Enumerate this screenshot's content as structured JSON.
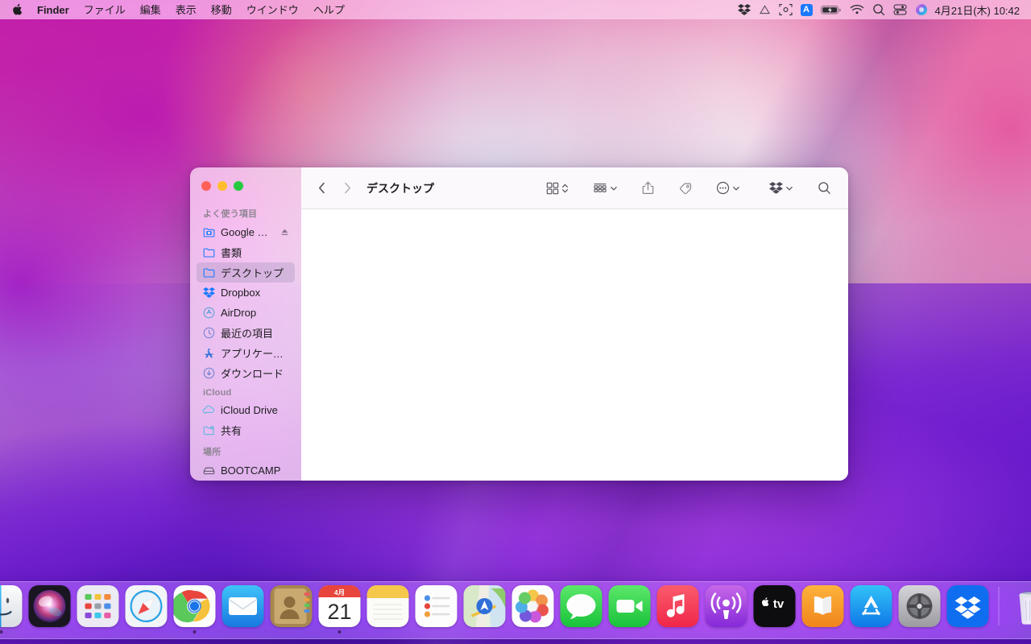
{
  "menubar": {
    "apple_icon": "apple-logo-icon",
    "app_name": "Finder",
    "items": [
      {
        "label": "Finder",
        "bold": true
      },
      {
        "label": "ファイル",
        "bold": false
      },
      {
        "label": "編集",
        "bold": false
      },
      {
        "label": "表示",
        "bold": false
      },
      {
        "label": "移動",
        "bold": false
      },
      {
        "label": "ウインドウ",
        "bold": false
      },
      {
        "label": "ヘルプ",
        "bold": false
      }
    ],
    "status_icons": [
      {
        "name": "dropbox-menu-icon"
      },
      {
        "name": "google-drive-menu-icon"
      },
      {
        "name": "screenshot-capture-icon"
      },
      {
        "name": "input-source-icon",
        "label": "A"
      },
      {
        "name": "battery-charging-icon"
      },
      {
        "name": "wifi-icon"
      },
      {
        "name": "spotlight-search-icon"
      },
      {
        "name": "control-center-icon"
      },
      {
        "name": "siri-icon"
      }
    ],
    "clock": "4月21日(木)  10:42"
  },
  "finder": {
    "window_title": "デスクトップ",
    "traffic_lights": [
      {
        "name": "close-button",
        "color": "#ff6159"
      },
      {
        "name": "minimize-button",
        "color": "#ffbd2e"
      },
      {
        "name": "maximize-button",
        "color": "#27c93f"
      }
    ],
    "sidebar": {
      "groups": [
        {
          "title": "よく使う項目",
          "items": [
            {
              "label": "Google Dri...",
              "icon": "google-drive-folder-icon",
              "eject": true,
              "selected": false
            },
            {
              "label": "書類",
              "icon": "documents-folder-icon",
              "eject": false,
              "selected": false
            },
            {
              "label": "デスクトップ",
              "icon": "desktop-folder-icon",
              "eject": false,
              "selected": true
            },
            {
              "label": "Dropbox",
              "icon": "dropbox-icon",
              "eject": false,
              "selected": false
            },
            {
              "label": "AirDrop",
              "icon": "airdrop-icon",
              "eject": false,
              "selected": false
            },
            {
              "label": "最近の項目",
              "icon": "recents-clock-icon",
              "eject": false,
              "selected": false
            },
            {
              "label": "アプリケーション",
              "icon": "applications-icon",
              "eject": false,
              "selected": false
            },
            {
              "label": "ダウンロード",
              "icon": "downloads-icon",
              "eject": false,
              "selected": false
            }
          ]
        },
        {
          "title": "iCloud",
          "items": [
            {
              "label": "iCloud Drive",
              "icon": "icloud-drive-icon",
              "eject": false,
              "selected": false
            },
            {
              "label": "共有",
              "icon": "shared-folder-icon",
              "eject": false,
              "selected": false
            }
          ]
        },
        {
          "title": "場所",
          "items": [
            {
              "label": "BOOTCAMP",
              "icon": "external-disk-icon",
              "eject": false,
              "selected": false
            }
          ]
        }
      ]
    },
    "toolbar": {
      "back": {
        "name": "back-button",
        "enabled": true
      },
      "forward": {
        "name": "forward-button",
        "enabled": false
      },
      "buttons": [
        {
          "name": "view-mode-icon-grid",
          "caret": "updown"
        },
        {
          "name": "group-by-button",
          "caret": "down"
        },
        {
          "name": "share-button",
          "caret": "none"
        },
        {
          "name": "tag-button",
          "caret": "none"
        },
        {
          "name": "more-actions-button",
          "caret": "down"
        },
        {
          "name": "dropbox-toolbar-button",
          "caret": "down"
        },
        {
          "name": "search-button",
          "caret": "none"
        }
      ]
    },
    "content": {
      "empty": true,
      "items": []
    }
  },
  "dock": {
    "apps": [
      {
        "name": "finder",
        "label": "Finder",
        "running": true
      },
      {
        "name": "siri",
        "label": "Siri",
        "running": false
      },
      {
        "name": "launchpad",
        "label": "Launchpad",
        "running": false
      },
      {
        "name": "safari",
        "label": "Safari",
        "running": false
      },
      {
        "name": "chrome",
        "label": "Google Chrome",
        "running": true
      },
      {
        "name": "mail",
        "label": "メール",
        "running": false
      },
      {
        "name": "contacts",
        "label": "連絡先",
        "running": false
      },
      {
        "name": "calendar",
        "label": "カレンダー",
        "running": true,
        "month": "4月",
        "day": "21"
      },
      {
        "name": "notes",
        "label": "メモ",
        "running": false
      },
      {
        "name": "reminders",
        "label": "リマインダー",
        "running": false
      },
      {
        "name": "maps",
        "label": "マップ",
        "running": false
      },
      {
        "name": "photos",
        "label": "写真",
        "running": false
      },
      {
        "name": "messages",
        "label": "メッセージ",
        "running": false
      },
      {
        "name": "facetime",
        "label": "FaceTime",
        "running": false
      },
      {
        "name": "music",
        "label": "ミュージック",
        "running": false
      },
      {
        "name": "podcasts",
        "label": "Podcast",
        "running": false
      },
      {
        "name": "appletv",
        "label": "Apple TV",
        "running": false
      },
      {
        "name": "books",
        "label": "ブック",
        "running": false
      },
      {
        "name": "appstore",
        "label": "App Store",
        "running": false
      },
      {
        "name": "system-preferences",
        "label": "システム環境設定",
        "running": false
      },
      {
        "name": "dropbox",
        "label": "Dropbox",
        "running": false
      }
    ],
    "trash": {
      "name": "trash",
      "label": "ゴミ箱"
    }
  },
  "colors": {
    "accent_blue": "#1a7aff",
    "selection": "#af9bc3",
    "window_bg": "#ffffff",
    "sidebar_bg": "#f3d8ee"
  }
}
